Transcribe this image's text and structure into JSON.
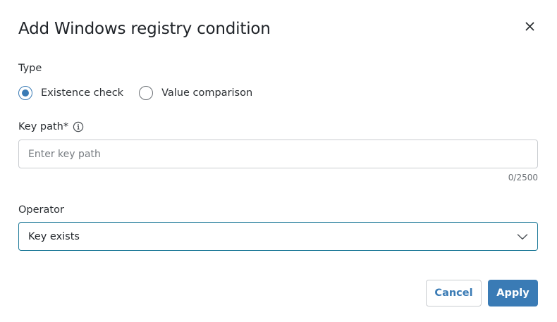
{
  "dialog": {
    "title": "Add Windows registry condition"
  },
  "type_field": {
    "label": "Type",
    "options": [
      {
        "label": "Existence check",
        "selected": true
      },
      {
        "label": "Value comparison",
        "selected": false
      }
    ]
  },
  "key_path": {
    "label": "Key path*",
    "placeholder": "Enter key path",
    "value": "",
    "counter": "0/2500"
  },
  "operator": {
    "label": "Operator",
    "selected": "Key exists"
  },
  "actions": {
    "cancel_label": "Cancel",
    "apply_label": "Apply"
  },
  "colors": {
    "accent": "#3a7bb5",
    "focus_border": "#1f7a99"
  },
  "icons": {
    "close": "close-icon",
    "info": "info-icon",
    "dropdown": "chevron-down-icon"
  }
}
